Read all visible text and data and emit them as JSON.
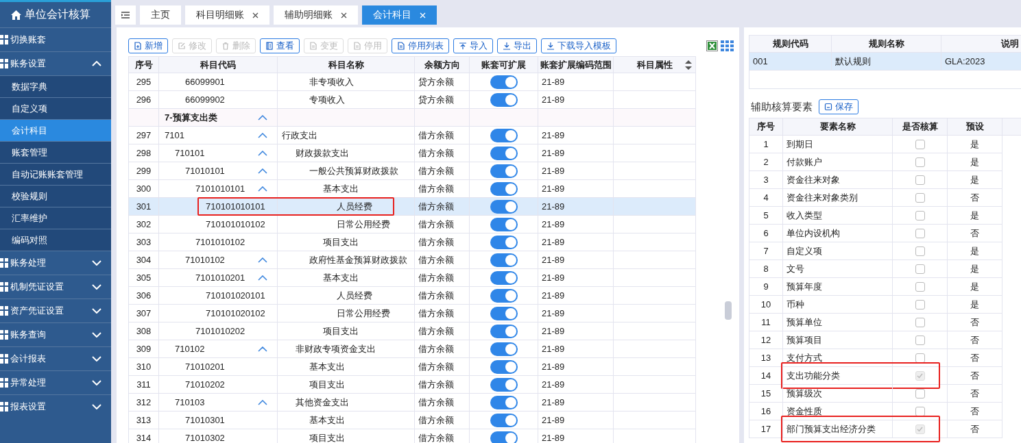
{
  "sidebar": {
    "title": "单位会计核算",
    "items": [
      {
        "label": "切换账套"
      },
      {
        "label": "账务设置",
        "expanded": true,
        "children": [
          {
            "label": "数据字典",
            "selected": false
          },
          {
            "label": "自定义项",
            "selected": false
          },
          {
            "label": "会计科目",
            "selected": true
          },
          {
            "label": "账套管理",
            "selected": false
          },
          {
            "label": "自动记账账套管理",
            "selected": false
          },
          {
            "label": "校验规则",
            "selected": false
          },
          {
            "label": "汇率维护",
            "selected": false
          },
          {
            "label": "编码对照",
            "selected": false
          }
        ]
      },
      {
        "label": "账务处理",
        "expanded": false
      },
      {
        "label": "机制凭证设置",
        "expanded": false
      },
      {
        "label": "资产凭证设置",
        "expanded": false
      },
      {
        "label": "账务查询",
        "expanded": false
      },
      {
        "label": "会计报表",
        "expanded": false
      },
      {
        "label": "异常处理",
        "expanded": false
      },
      {
        "label": "报表设置",
        "expanded": false
      }
    ]
  },
  "tabs": [
    {
      "label": "主页",
      "selected": false,
      "closable": false
    },
    {
      "label": "科目明细账",
      "selected": false,
      "closable": true
    },
    {
      "label": "辅助明细账",
      "selected": false,
      "closable": true
    },
    {
      "label": "会计科目",
      "selected": true,
      "closable": true
    }
  ],
  "toolbar": {
    "buttons": [
      {
        "label": "新增",
        "kind": "add",
        "disabled": false
      },
      {
        "label": "修改",
        "kind": "edit",
        "disabled": true
      },
      {
        "label": "删除",
        "kind": "delete",
        "disabled": true
      },
      {
        "label": "查看",
        "kind": "view",
        "disabled": false
      },
      {
        "label": "变更",
        "kind": "doc",
        "disabled": true
      },
      {
        "label": "停用",
        "kind": "doc",
        "disabled": true
      },
      {
        "label": "停用列表",
        "kind": "doc",
        "disabled": false
      },
      {
        "label": "导入",
        "kind": "upload",
        "disabled": false
      },
      {
        "label": "导出",
        "kind": "download",
        "disabled": false
      },
      {
        "label": "下载导入模板",
        "kind": "download",
        "disabled": false
      }
    ]
  },
  "accounts": {
    "columns": [
      "序号",
      "科目代码",
      "科目名称",
      "余额方向",
      "账套可扩展",
      "账套扩展编码范围",
      "科目属性"
    ],
    "continued_rows": [
      {
        "seq": "295",
        "code": "66099901",
        "name": "非专项收入",
        "direction": "贷方余额",
        "extendable": true,
        "range": "21-89",
        "selected": false
      },
      {
        "seq": "296",
        "code": "66099902",
        "name": "专项收入",
        "direction": "贷方余额",
        "extendable": true,
        "range": "21-89",
        "selected": false
      }
    ],
    "rows": [
      {
        "kind": "group",
        "code": "7-预算支出类",
        "expanded": true,
        "selected": false,
        "children": [
          {
            "seq": "297",
            "code": "7101",
            "name": "行政支出",
            "direction": "借方余额",
            "extendable": true,
            "range": "21-89",
            "selected": false,
            "expanded": true,
            "children": [
              {
                "seq": "298",
                "code": "710101",
                "name": "财政拨款支出",
                "direction": "借方余额",
                "extendable": true,
                "range": "21-89",
                "selected": false,
                "expanded": true,
                "children": [
                  {
                    "seq": "299",
                    "code": "71010101",
                    "name": "一般公共预算财政拨款",
                    "direction": "借方余额",
                    "extendable": true,
                    "range": "21-89",
                    "selected": false,
                    "expanded": true,
                    "children": [
                      {
                        "seq": "300",
                        "code": "7101010101",
                        "name": "基本支出",
                        "direction": "借方余额",
                        "extendable": true,
                        "range": "21-89",
                        "selected": false,
                        "expanded": true,
                        "children": [
                          {
                            "seq": "301",
                            "code": "710101010101",
                            "name": "人员经费",
                            "direction": "借方余额",
                            "extendable": true,
                            "range": "21-89",
                            "selected": true,
                            "annotated": true
                          },
                          {
                            "seq": "302",
                            "code": "710101010102",
                            "name": "日常公用经费",
                            "direction": "借方余额",
                            "extendable": true,
                            "range": "21-89",
                            "selected": false
                          }
                        ]
                      },
                      {
                        "seq": "303",
                        "code": "7101010102",
                        "name": "项目支出",
                        "direction": "借方余额",
                        "extendable": true,
                        "range": "21-89",
                        "selected": false
                      }
                    ]
                  },
                  {
                    "seq": "304",
                    "code": "71010102",
                    "name": "政府性基金预算财政拨款",
                    "direction": "借方余额",
                    "extendable": true,
                    "range": "21-89",
                    "selected": false,
                    "expanded": true,
                    "children": [
                      {
                        "seq": "305",
                        "code": "7101010201",
                        "name": "基本支出",
                        "direction": "借方余额",
                        "extendable": true,
                        "range": "21-89",
                        "selected": false,
                        "expanded": true,
                        "children": [
                          {
                            "seq": "306",
                            "code": "710101020101",
                            "name": "人员经费",
                            "direction": "借方余额",
                            "extendable": true,
                            "range": "21-89",
                            "selected": false
                          },
                          {
                            "seq": "307",
                            "code": "710101020102",
                            "name": "日常公用经费",
                            "direction": "借方余额",
                            "extendable": true,
                            "range": "21-89",
                            "selected": false
                          }
                        ]
                      },
                      {
                        "seq": "308",
                        "code": "7101010202",
                        "name": "项目支出",
                        "direction": "借方余额",
                        "extendable": true,
                        "range": "21-89",
                        "selected": false
                      }
                    ]
                  }
                ]
              },
              {
                "seq": "309",
                "code": "710102",
                "name": "非财政专项资金支出",
                "direction": "借方余额",
                "extendable": true,
                "range": "21-89",
                "selected": false,
                "expanded": true,
                "children": [
                  {
                    "seq": "310",
                    "code": "71010201",
                    "name": "基本支出",
                    "direction": "借方余额",
                    "extendable": true,
                    "range": "21-89",
                    "selected": false
                  },
                  {
                    "seq": "311",
                    "code": "71010202",
                    "name": "项目支出",
                    "direction": "借方余额",
                    "extendable": true,
                    "range": "21-89",
                    "selected": false
                  }
                ]
              },
              {
                "seq": "312",
                "code": "710103",
                "name": "其他资金支出",
                "direction": "借方余额",
                "extendable": true,
                "range": "21-89",
                "selected": false,
                "expanded": true,
                "children": [
                  {
                    "seq": "313",
                    "code": "71010301",
                    "name": "基本支出",
                    "direction": "借方余额",
                    "extendable": true,
                    "range": "21-89",
                    "selected": false
                  },
                  {
                    "seq": "314",
                    "code": "71010302",
                    "name": "项目支出",
                    "direction": "借方余额",
                    "extendable": true,
                    "range": "21-89",
                    "selected": false
                  }
                ]
              }
            ]
          }
        ]
      }
    ]
  },
  "rules": {
    "columns": [
      "规则代码",
      "规则名称",
      "说明"
    ],
    "rows": [
      {
        "code": "001",
        "name": "默认规则",
        "description": "GLA:2023",
        "selected": true
      }
    ]
  },
  "aux": {
    "title": "辅助核算要素",
    "save_button": "保存",
    "columns": [
      "序号",
      "要素名称",
      "是否核算",
      "预设"
    ],
    "rows": [
      {
        "seq": "1",
        "name": "到期日",
        "checked": false,
        "disabled": false,
        "preset": "是"
      },
      {
        "seq": "2",
        "name": "付款账户",
        "checked": false,
        "disabled": false,
        "preset": "是"
      },
      {
        "seq": "3",
        "name": "资金往来对象",
        "checked": false,
        "disabled": false,
        "preset": "是"
      },
      {
        "seq": "4",
        "name": "资金往来对象类别",
        "checked": false,
        "disabled": false,
        "preset": "否"
      },
      {
        "seq": "5",
        "name": "收入类型",
        "checked": false,
        "disabled": false,
        "preset": "是"
      },
      {
        "seq": "6",
        "name": "单位内设机构",
        "checked": false,
        "disabled": false,
        "preset": "否"
      },
      {
        "seq": "7",
        "name": "自定义项",
        "checked": false,
        "disabled": false,
        "preset": "是"
      },
      {
        "seq": "8",
        "name": "文号",
        "checked": false,
        "disabled": false,
        "preset": "是"
      },
      {
        "seq": "9",
        "name": "预算年度",
        "checked": false,
        "disabled": false,
        "preset": "是"
      },
      {
        "seq": "10",
        "name": "币种",
        "checked": false,
        "disabled": false,
        "preset": "是"
      },
      {
        "seq": "11",
        "name": "预算单位",
        "checked": false,
        "disabled": false,
        "preset": "否"
      },
      {
        "seq": "12",
        "name": "预算项目",
        "checked": false,
        "disabled": false,
        "preset": "否"
      },
      {
        "seq": "13",
        "name": "支付方式",
        "checked": false,
        "disabled": false,
        "preset": "否"
      },
      {
        "seq": "14",
        "name": "支出功能分类",
        "checked": true,
        "disabled": true,
        "preset": "否",
        "annotated": true
      },
      {
        "seq": "15",
        "name": "预算级次",
        "checked": false,
        "disabled": false,
        "preset": "否"
      },
      {
        "seq": "16",
        "name": "资金性质",
        "checked": false,
        "disabled": false,
        "preset": "否"
      },
      {
        "seq": "17",
        "name": "部门预算支出经济分类",
        "checked": true,
        "disabled": true,
        "preset": "否",
        "annotated": true
      }
    ]
  }
}
